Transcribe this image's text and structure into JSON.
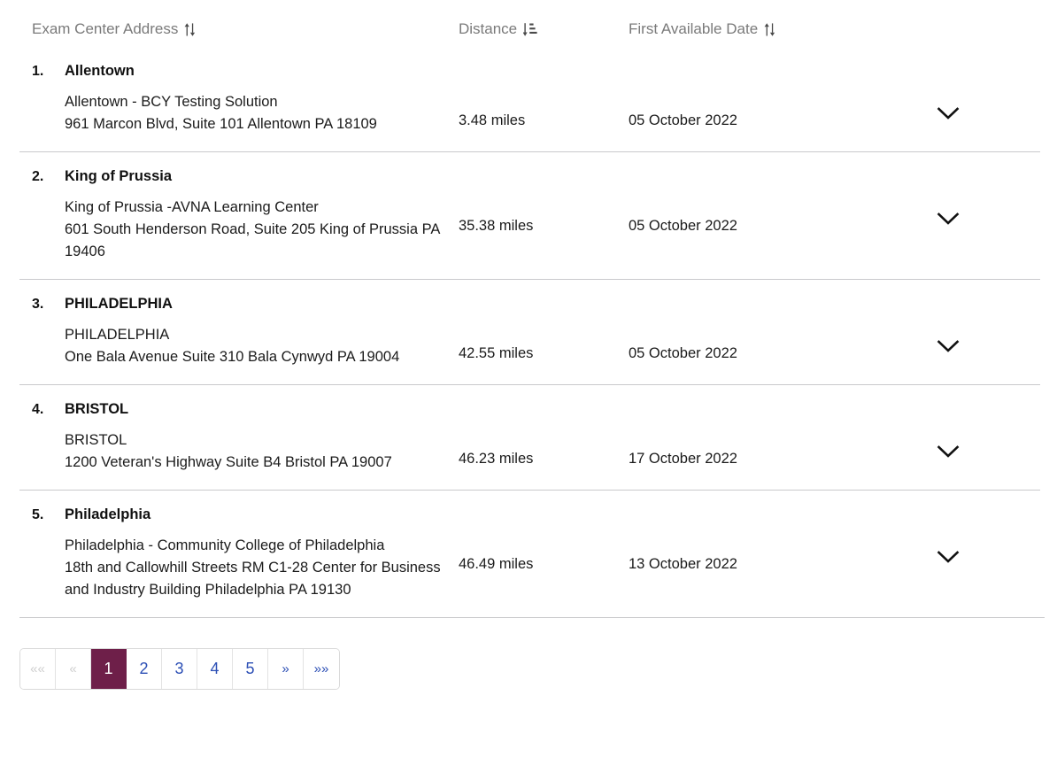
{
  "table": {
    "columns": [
      {
        "label": "Exam Center Address",
        "sort_icon": "sort-updown-icon",
        "sort_state": "none"
      },
      {
        "label": "Distance",
        "sort_icon": "sort-amount-down-icon",
        "sort_state": "ascending"
      },
      {
        "label": "First Available Date",
        "sort_icon": "sort-updown-icon",
        "sort_state": "none"
      }
    ],
    "rows": [
      {
        "index": "1.",
        "title": "Allentown",
        "center_name": "Allentown - BCY Testing Solution",
        "address_line1": "961 Marcon Blvd, Suite 101 Allentown PA 18109",
        "address_line2": "",
        "distance": "3.48 miles",
        "first_available_date": "05 October 2022",
        "expand_icon": "chevron-down-icon"
      },
      {
        "index": "2.",
        "title": "King of Prussia",
        "center_name": "King of Prussia -AVNA Learning Center",
        "address_line1": "601 South Henderson Road, Suite 205 King of Prussia PA",
        "address_line2": "19406",
        "distance": "35.38 miles",
        "first_available_date": "05 October 2022",
        "expand_icon": "chevron-down-icon"
      },
      {
        "index": "3.",
        "title": "PHILADELPHIA",
        "center_name": "PHILADELPHIA",
        "address_line1": "One Bala Avenue Suite 310 Bala Cynwyd PA 19004",
        "address_line2": "",
        "distance": "42.55 miles",
        "first_available_date": "05 October 2022",
        "expand_icon": "chevron-down-icon"
      },
      {
        "index": "4.",
        "title": "BRISTOL",
        "center_name": "BRISTOL",
        "address_line1": "1200 Veteran's Highway Suite B4 Bristol PA 19007",
        "address_line2": "",
        "distance": "46.23 miles",
        "first_available_date": "17 October 2022",
        "expand_icon": "chevron-down-icon"
      },
      {
        "index": "5.",
        "title": "Philadelphia",
        "center_name": "Philadelphia - Community College of Philadelphia",
        "address_line1": "18th and Callowhill Streets RM C1-28 Center for Business",
        "address_line2": "and Industry Building Philadelphia PA 19130",
        "distance": "46.49 miles",
        "first_available_date": "13 October 2022",
        "expand_icon": "chevron-down-icon"
      }
    ]
  },
  "pagination": {
    "first_label": "««",
    "prev_label": "«",
    "next_label": "»",
    "last_label": "»»",
    "pages": [
      "1",
      "2",
      "3",
      "4",
      "5"
    ],
    "active_page": "1",
    "first_disabled": true,
    "prev_disabled": true
  },
  "colors": {
    "active_page_bg": "#6e1f49",
    "link": "#2c4fb5",
    "disabled": "#cfcfcf",
    "header_text": "#7a7a7a",
    "divider": "#c9c9cc",
    "body_text": "#1b1b1b"
  }
}
